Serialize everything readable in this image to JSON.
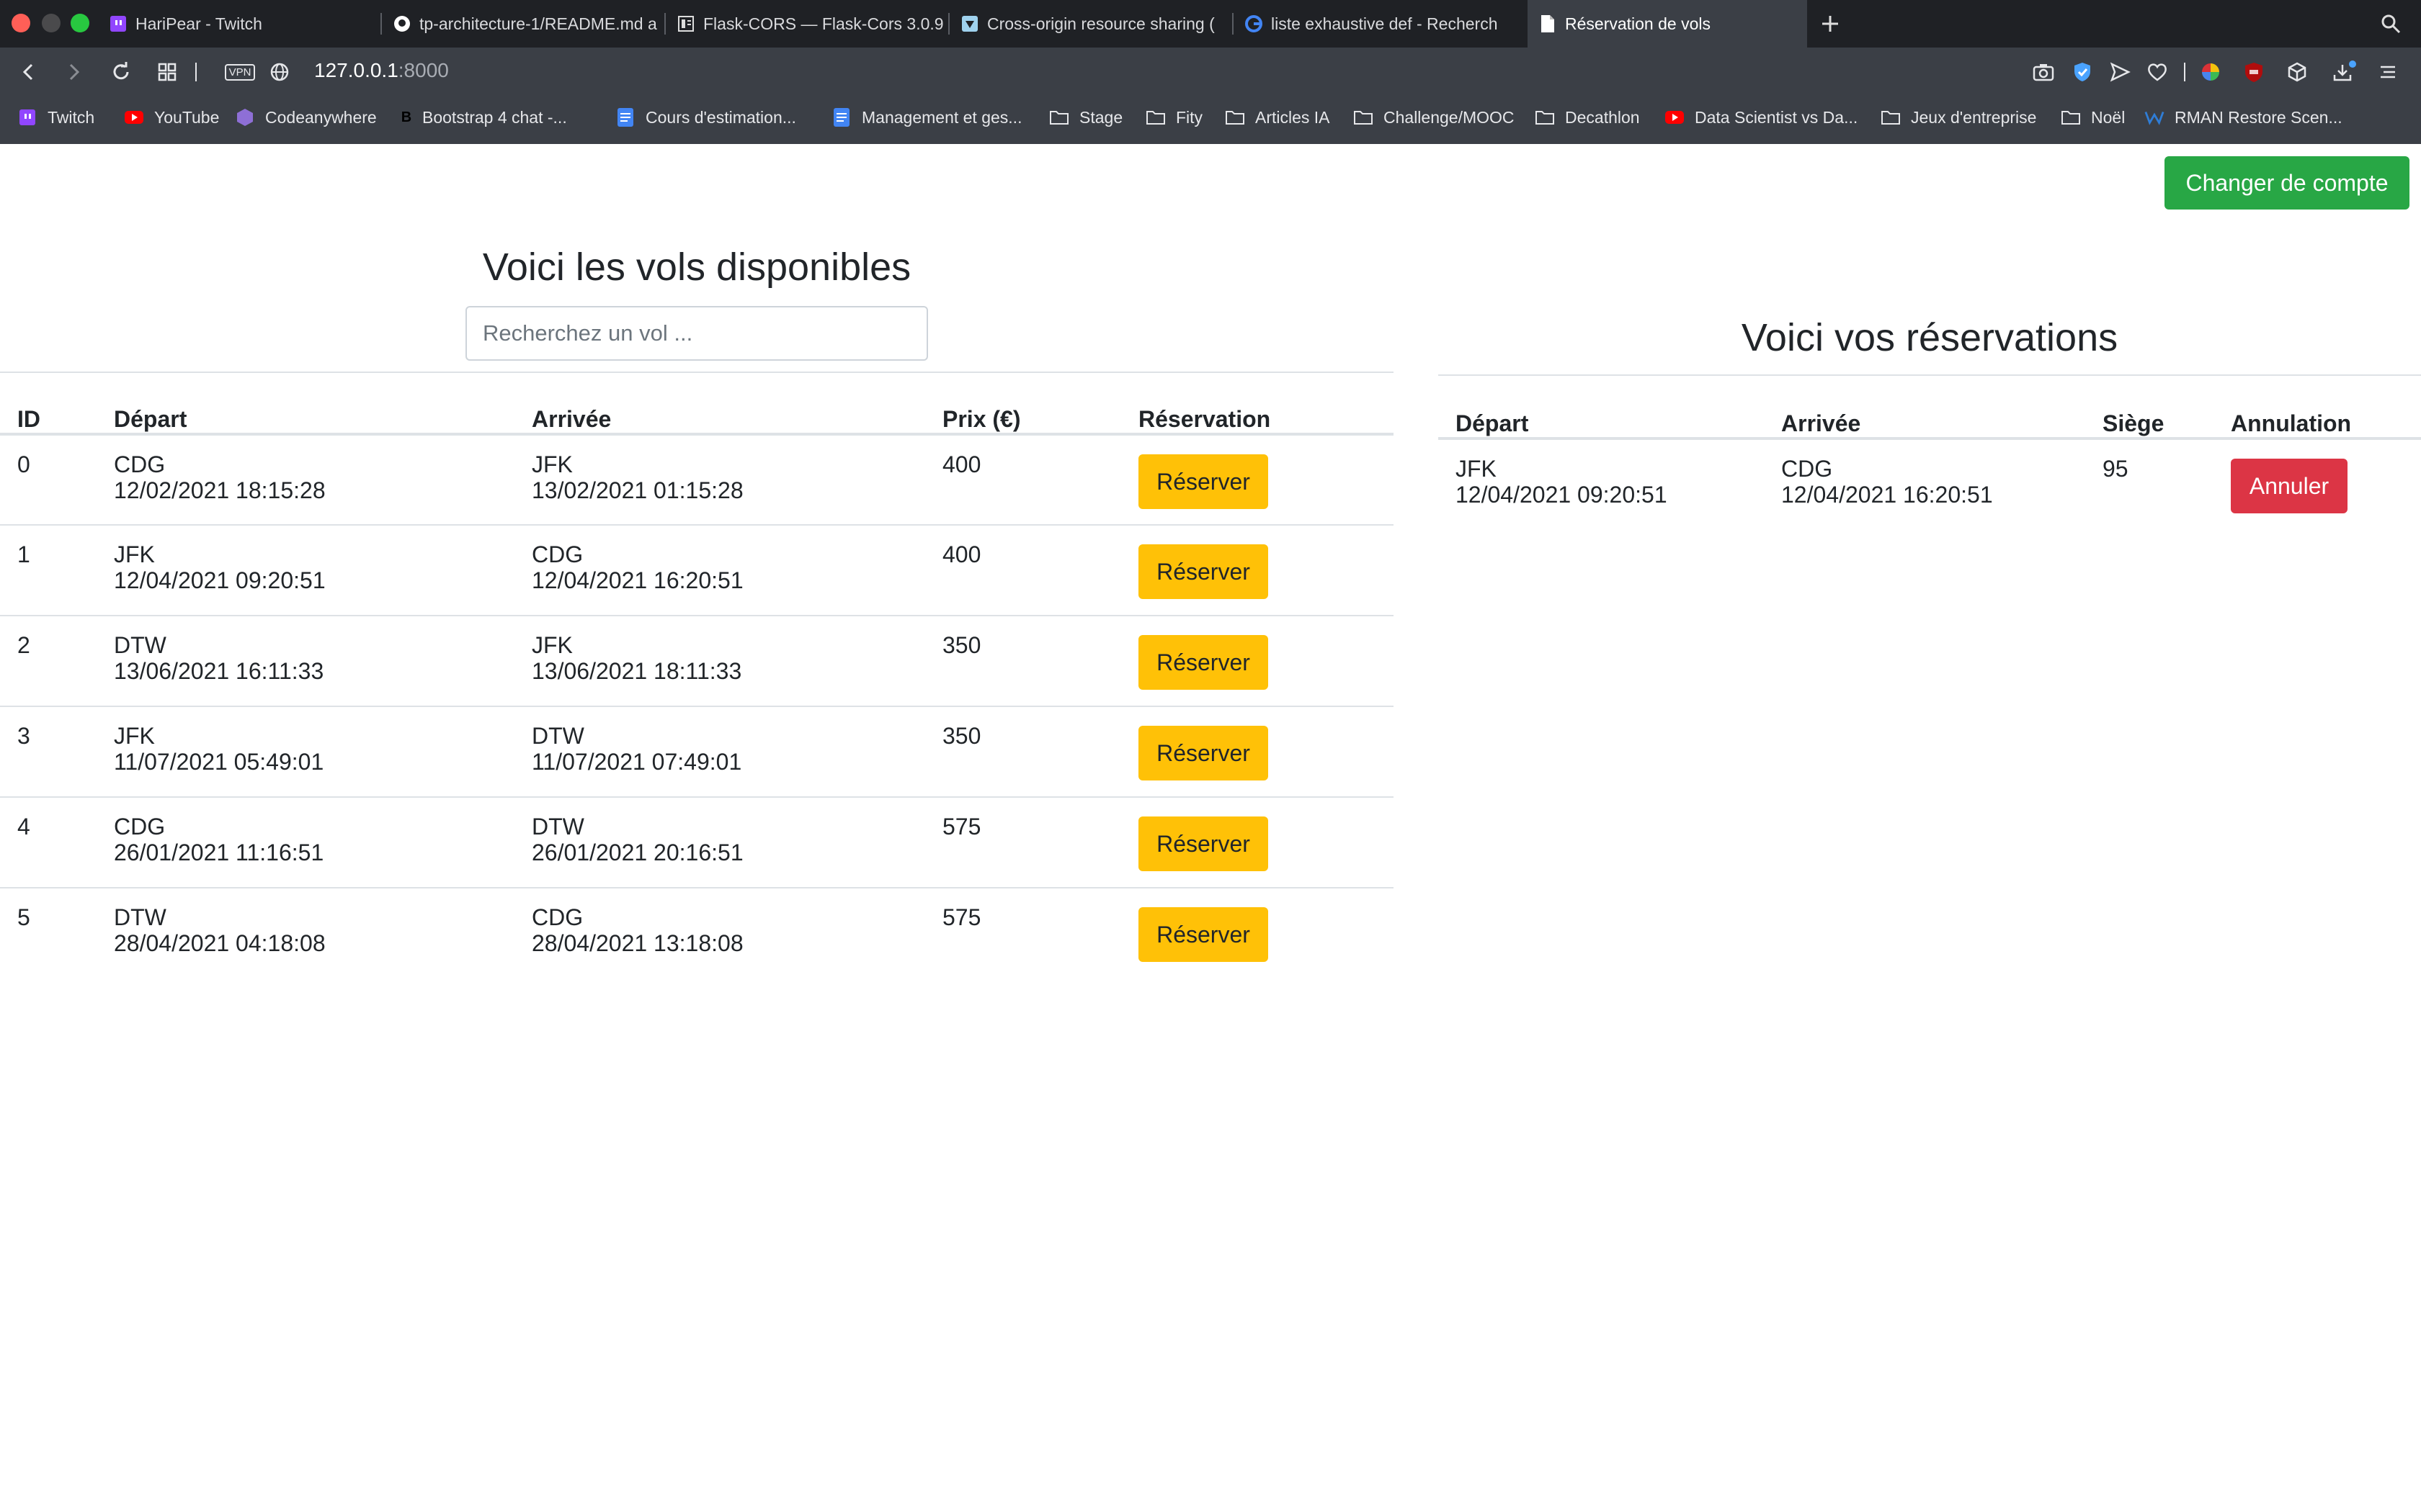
{
  "browser": {
    "tabs": [
      {
        "label": "HariPear - Twitch"
      },
      {
        "label": "tp-architecture-1/README.md a"
      },
      {
        "label": "Flask-CORS — Flask-Cors 3.0.9"
      },
      {
        "label": "Cross-origin resource sharing ("
      },
      {
        "label": "liste exhaustive def - Recherch"
      },
      {
        "label": "Réservation de vols"
      }
    ],
    "vpn_label": "VPN",
    "url": {
      "host": "127.0.0.1",
      "port": ":8000"
    },
    "bookmarks": [
      {
        "label": "Twitch",
        "icon": "twitch-icon"
      },
      {
        "label": "YouTube",
        "icon": "youtube-icon"
      },
      {
        "label": "Codeanywhere",
        "icon": "codeanywhere-icon"
      },
      {
        "label": "Bootstrap 4 chat -...",
        "icon": "bootstrap-icon"
      },
      {
        "label": "Cours d'estimation...",
        "icon": "docs-icon"
      },
      {
        "label": "Management et ges...",
        "icon": "docs-icon"
      },
      {
        "label": "Stage",
        "icon": "folder-icon"
      },
      {
        "label": "Fity",
        "icon": "folder-icon"
      },
      {
        "label": "Articles IA",
        "icon": "folder-icon"
      },
      {
        "label": "Challenge/MOOC",
        "icon": "folder-icon"
      },
      {
        "label": "Decathlon",
        "icon": "folder-icon"
      },
      {
        "label": "Data Scientist vs Da...",
        "icon": "youtube-icon"
      },
      {
        "label": "Jeux d'entreprise",
        "icon": "folder-icon"
      },
      {
        "label": "Noël",
        "icon": "folder-icon"
      },
      {
        "label": "RMAN Restore Scen...",
        "icon": "w-icon"
      }
    ]
  },
  "page": {
    "switch_account_label": "Changer de compte",
    "flights": {
      "title": "Voici les vols disponibles",
      "search_placeholder": "Recherchez un vol ...",
      "columns": [
        "ID",
        "Départ",
        "Arrivée",
        "Prix (€)",
        "Réservation"
      ],
      "rows": [
        {
          "id": "0",
          "dep_code": "CDG",
          "dep_time": "12/02/2021 18:15:28",
          "arr_code": "JFK",
          "arr_time": "13/02/2021 01:15:28",
          "price": "400",
          "action": "Réserver"
        },
        {
          "id": "1",
          "dep_code": "JFK",
          "dep_time": "12/04/2021 09:20:51",
          "arr_code": "CDG",
          "arr_time": "12/04/2021 16:20:51",
          "price": "400",
          "action": "Réserver"
        },
        {
          "id": "2",
          "dep_code": "DTW",
          "dep_time": "13/06/2021 16:11:33",
          "arr_code": "JFK",
          "arr_time": "13/06/2021 18:11:33",
          "price": "350",
          "action": "Réserver"
        },
        {
          "id": "3",
          "dep_code": "JFK",
          "dep_time": "11/07/2021 05:49:01",
          "arr_code": "DTW",
          "arr_time": "11/07/2021 07:49:01",
          "price": "350",
          "action": "Réserver"
        },
        {
          "id": "4",
          "dep_code": "CDG",
          "dep_time": "26/01/2021 11:16:51",
          "arr_code": "DTW",
          "arr_time": "26/01/2021 20:16:51",
          "price": "575",
          "action": "Réserver"
        },
        {
          "id": "5",
          "dep_code": "DTW",
          "dep_time": "28/04/2021 04:18:08",
          "arr_code": "CDG",
          "arr_time": "28/04/2021 13:18:08",
          "price": "575",
          "action": "Réserver"
        }
      ]
    },
    "reservations": {
      "title": "Voici vos réservations",
      "columns": [
        "Départ",
        "Arrivée",
        "Siège",
        "Annulation"
      ],
      "rows": [
        {
          "dep_code": "JFK",
          "dep_time": "12/04/2021 09:20:51",
          "arr_code": "CDG",
          "arr_time": "12/04/2021 16:20:51",
          "seat": "95",
          "action": "Annuler"
        }
      ]
    }
  },
  "colors": {
    "chrome_tabbar": "#1f2125",
    "chrome_toolbar": "#3b3f46",
    "success": "#28a745",
    "warning": "#ffc107",
    "danger": "#dc3545"
  }
}
